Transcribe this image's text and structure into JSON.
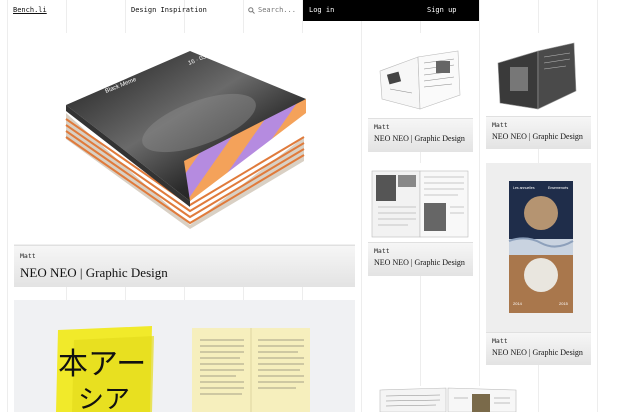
{
  "header": {
    "logo": "Bench.li",
    "nav_label": "Design Inspiration",
    "search_placeholder": "Search...",
    "login_label": "Log in",
    "signup_label": "Sign up"
  },
  "cards": [
    {
      "user": "Matt",
      "title": "NEO NEO | Graphic Design",
      "image": "stacked-magazines"
    },
    {
      "user": "Matt",
      "title": "NEO NEO | Graphic Design",
      "image": "open-magazine-white"
    },
    {
      "user": "Matt",
      "title": "NEO NEO | Graphic Design",
      "image": "open-magazine-dark"
    },
    {
      "user": "Matt",
      "title": "NEO NEO | Graphic Design",
      "image": "open-magazine-spread"
    },
    {
      "user": "Matt",
      "title": "NEO NEO | Graphic Design",
      "image": "poster-circles"
    },
    {
      "user": "",
      "title": "",
      "image": "yellow-booklet"
    },
    {
      "user": "",
      "title": "",
      "image": "open-booklet"
    }
  ],
  "colors": {
    "background": "#ffffff",
    "accent": "#000000",
    "stripe_orange": "#f4a25a",
    "stripe_purple": "#b58be0"
  }
}
